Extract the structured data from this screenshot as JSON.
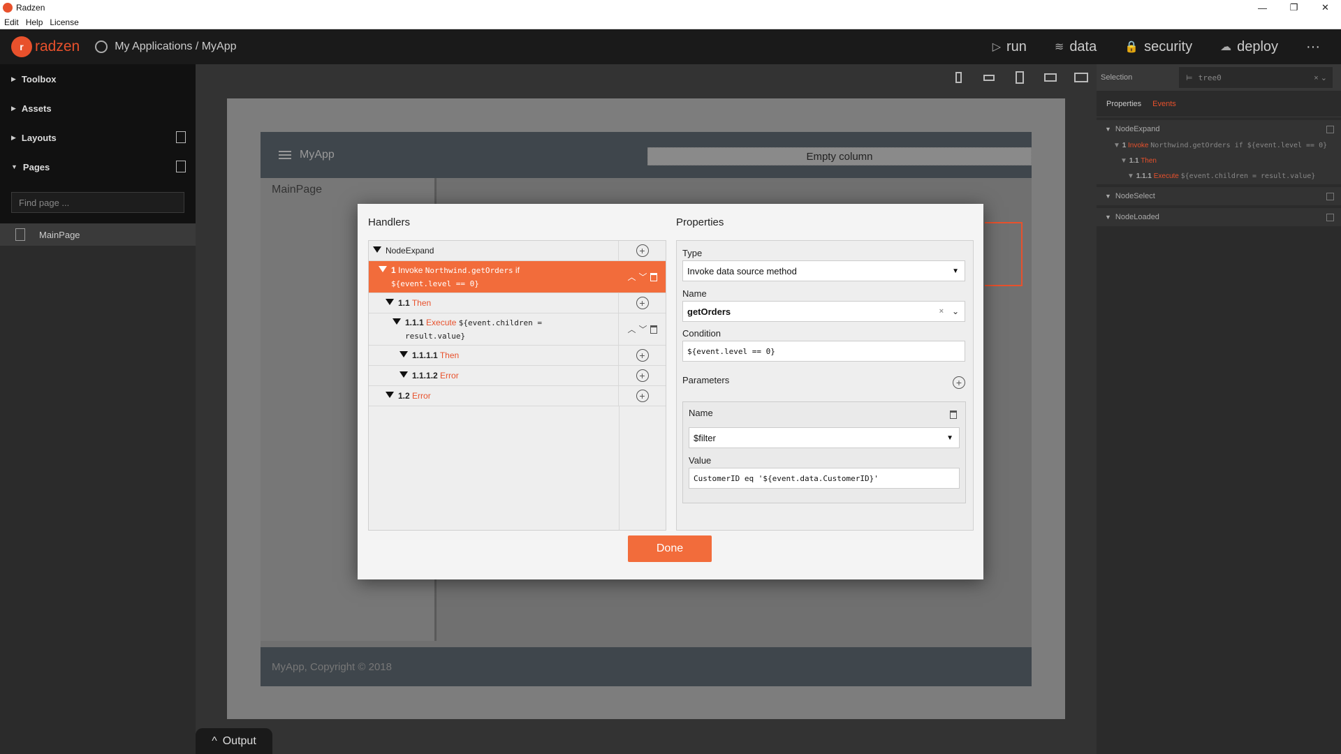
{
  "window": {
    "title": "Radzen",
    "minimize": "—",
    "restore": "❐",
    "close": "✕"
  },
  "menu": [
    "Edit",
    "Help",
    "License"
  ],
  "header": {
    "logo": "radzen",
    "breadcrumb": "My Applications / MyApp",
    "nav": [
      {
        "label": "run",
        "icon": "▷"
      },
      {
        "label": "data",
        "icon": "≋"
      },
      {
        "label": "security",
        "icon": "🔒"
      },
      {
        "label": "deploy",
        "icon": "☁"
      }
    ],
    "more": "···"
  },
  "sidebar": {
    "sections": [
      "Toolbox",
      "Assets",
      "Layouts",
      "Pages"
    ],
    "find_placeholder": "Find page ...",
    "pages": [
      "MainPage"
    ]
  },
  "canvas": {
    "app_title": "MyApp",
    "empty_column": "Empty column",
    "side_label": "MainPage",
    "footer": "MyApp, Copyright © 2018"
  },
  "output": {
    "label": "Output",
    "icon": "^"
  },
  "right_panel": {
    "selection_label": "Selection",
    "selection_value": "tree0",
    "tabs": [
      "Properties",
      "Events"
    ],
    "events": [
      {
        "name": "NodeExpand",
        "lines": [
          {
            "num": "1",
            "kw": "Invoke",
            "rest": "Northwind.getOrders if ${event.level == 0}"
          },
          {
            "num": "1.1",
            "kw": "Then",
            "rest": ""
          },
          {
            "num": "1.1.1",
            "kw": "Execute",
            "rest": "${event.children = result.value}"
          }
        ]
      },
      {
        "name": "NodeSelect",
        "lines": []
      },
      {
        "name": "NodeLoaded",
        "lines": []
      }
    ]
  },
  "dialog": {
    "handlers_title": "Handlers",
    "properties_title": "Properties",
    "event_name": "NodeExpand",
    "handlers": [
      {
        "num": "1",
        "kw": "Invoke",
        "code": "Northwind.getOrders",
        "suffix": "if",
        "code2": "${event.level == 0}"
      },
      {
        "num": "1.1",
        "kw": "Then"
      },
      {
        "num": "1.1.1",
        "kw": "Execute",
        "code": "${event.children =",
        "code2": "result.value}"
      },
      {
        "num": "1.1.1.1",
        "kw": "Then"
      },
      {
        "num": "1.1.1.2",
        "kw": "Error"
      },
      {
        "num": "1.2",
        "kw": "Error"
      }
    ],
    "props": {
      "type_label": "Type",
      "type_value": "Invoke data source method",
      "name_label": "Name",
      "name_value": "getOrders",
      "condition_label": "Condition",
      "condition_value": "${event.level == 0}",
      "parameters_label": "Parameters",
      "param_name_label": "Name",
      "param_name_value": "$filter",
      "param_value_label": "Value",
      "param_value_value": "CustomerID eq '${event.data.CustomerID}'"
    },
    "done_label": "Done"
  },
  "colors": {
    "accent": "#e8512c",
    "selected_row": "#f26c3b"
  }
}
